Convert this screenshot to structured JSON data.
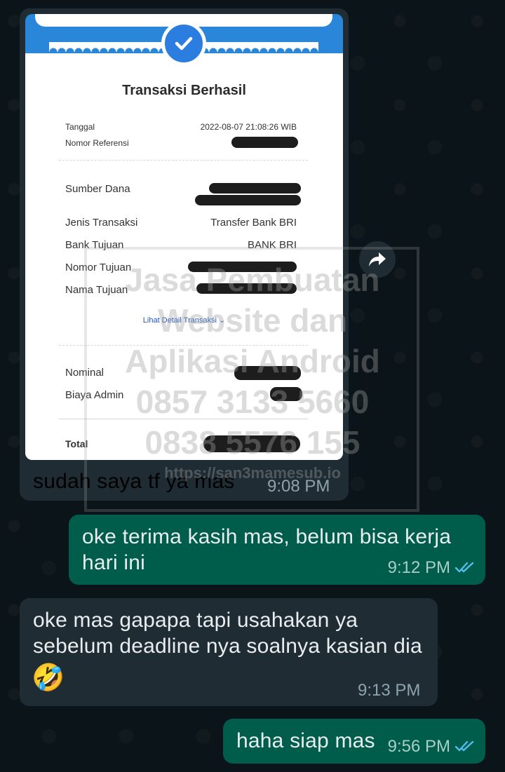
{
  "receipt": {
    "title": "Transaksi Berhasil",
    "tanggal_label": "Tanggal",
    "tanggal_value": "2022-08-07 21:08:26 WIB",
    "ref_label": "Nomor Referensi",
    "sumber_label": "Sumber Dana",
    "jenis_label": "Jenis Transaksi",
    "jenis_value": "Transfer Bank BRI",
    "bank_label": "Bank Tujuan",
    "bank_value": "BANK BRI",
    "nomor_label": "Nomor Tujuan",
    "nama_label": "Nama Tujuan",
    "detail_link": "Lihat Detail Transaksi",
    "nominal_label": "Nominal",
    "biaya_label": "Biaya Admin",
    "total_label": "Total"
  },
  "watermark": {
    "line1": "Jasa Pembuatan",
    "line2": "Website dan",
    "line3": "Aplikasi Android",
    "line4": "0857 3133 5660",
    "line5": "0838 5576 155",
    "url": "https://san3mamesub.io"
  },
  "messages": [
    {
      "text": "sudah saya tf ya mas",
      "time": "9:08 PM"
    },
    {
      "text": "oke terima kasih mas, belum bisa kerja hari ini",
      "time": "9:12 PM"
    },
    {
      "text": "oke mas gapapa tapi usahakan ya sebelum deadline nya soalnya kasian dia",
      "emoji": "🤣",
      "time": "9:13 PM"
    },
    {
      "text": "haha siap mas",
      "time": "9:56 PM"
    }
  ]
}
